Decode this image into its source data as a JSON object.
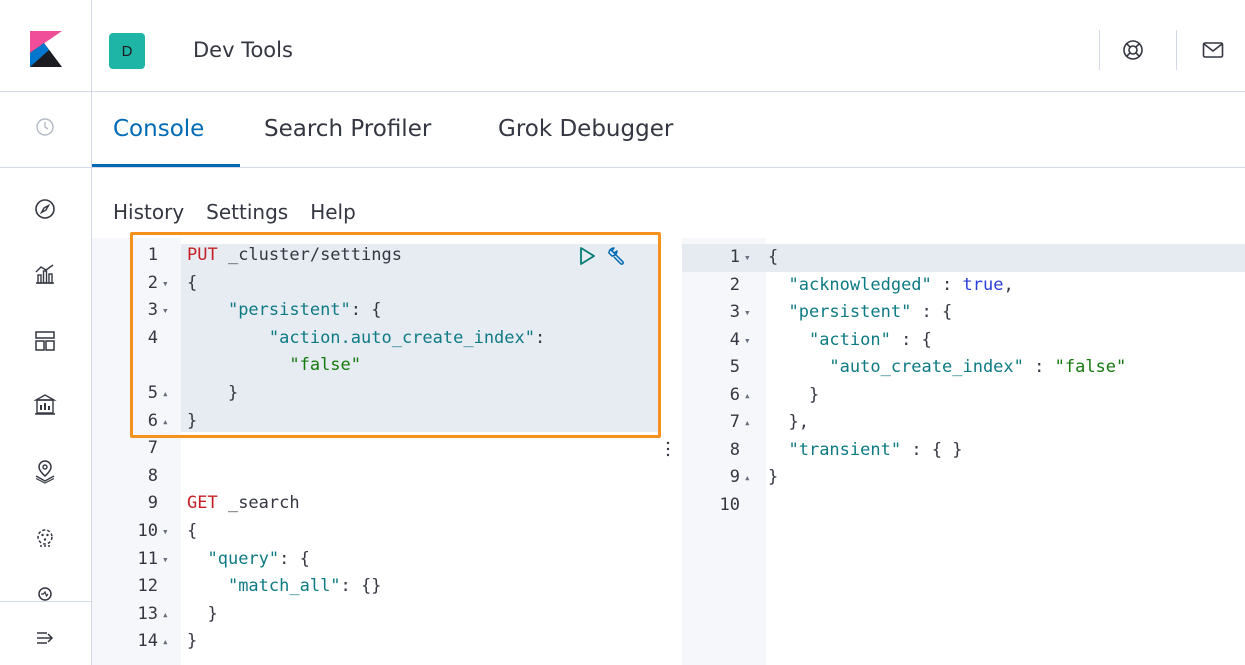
{
  "header": {
    "space_initial": "D",
    "app_title": "Dev Tools",
    "help_icon": "lifebuoy-icon",
    "mail_icon": "mail-icon"
  },
  "nav": {
    "icons": [
      "clock-icon",
      "compass-icon",
      "visualize-icon",
      "dashboard-icon",
      "canvas-icon",
      "maps-icon",
      "ml-icon",
      "uptime-icon",
      "expand-icon"
    ]
  },
  "tabs": [
    {
      "label": "Console",
      "active": true
    },
    {
      "label": "Search Profiler",
      "active": false
    },
    {
      "label": "Grok Debugger",
      "active": false
    }
  ],
  "menu": {
    "history": "History",
    "settings": "Settings",
    "help": "Help"
  },
  "request_lines": [
    {
      "n": "1",
      "fold": "",
      "tokens": [
        [
          "kw",
          "PUT"
        ],
        [
          "plain",
          " _cluster/settings"
        ]
      ]
    },
    {
      "n": "2",
      "fold": "▾",
      "tokens": [
        [
          "plain",
          "{"
        ]
      ]
    },
    {
      "n": "3",
      "fold": "▾",
      "tokens": [
        [
          "plain",
          "    "
        ],
        [
          "key",
          "\"persistent\""
        ],
        [
          "plain",
          ": {"
        ]
      ]
    },
    {
      "n": "4",
      "fold": "",
      "tokens": [
        [
          "plain",
          "        "
        ],
        [
          "key",
          "\"action.auto_create_index\""
        ],
        [
          "plain",
          ":"
        ]
      ]
    },
    {
      "n": "",
      "fold": "",
      "tokens": [
        [
          "plain",
          "          "
        ],
        [
          "str",
          "\"false\""
        ]
      ]
    },
    {
      "n": "5",
      "fold": "▴",
      "tokens": [
        [
          "plain",
          "    }"
        ]
      ]
    },
    {
      "n": "6",
      "fold": "▴",
      "tokens": [
        [
          "plain",
          "}"
        ]
      ]
    },
    {
      "n": "7",
      "fold": "",
      "tokens": []
    },
    {
      "n": "8",
      "fold": "",
      "tokens": []
    },
    {
      "n": "9",
      "fold": "",
      "tokens": [
        [
          "kw",
          "GET"
        ],
        [
          "plain",
          " _search"
        ]
      ]
    },
    {
      "n": "10",
      "fold": "▾",
      "tokens": [
        [
          "plain",
          "{"
        ]
      ]
    },
    {
      "n": "11",
      "fold": "▾",
      "tokens": [
        [
          "plain",
          "  "
        ],
        [
          "key",
          "\"query\""
        ],
        [
          "plain",
          ": {"
        ]
      ]
    },
    {
      "n": "12",
      "fold": "",
      "tokens": [
        [
          "plain",
          "    "
        ],
        [
          "key",
          "\"match_all\""
        ],
        [
          "plain",
          ": {}"
        ]
      ]
    },
    {
      "n": "13",
      "fold": "▴",
      "tokens": [
        [
          "plain",
          "  }"
        ]
      ]
    },
    {
      "n": "14",
      "fold": "▴",
      "tokens": [
        [
          "plain",
          "}"
        ]
      ]
    }
  ],
  "response_lines": [
    {
      "n": "1",
      "fold": "▾",
      "tokens": [
        [
          "plain",
          "{"
        ]
      ]
    },
    {
      "n": "2",
      "fold": "",
      "tokens": [
        [
          "plain",
          "  "
        ],
        [
          "key",
          "\"acknowledged\""
        ],
        [
          "plain",
          " : "
        ],
        [
          "bool",
          "true"
        ],
        [
          "plain",
          ","
        ]
      ]
    },
    {
      "n": "3",
      "fold": "▾",
      "tokens": [
        [
          "plain",
          "  "
        ],
        [
          "key",
          "\"persistent\""
        ],
        [
          "plain",
          " : {"
        ]
      ]
    },
    {
      "n": "4",
      "fold": "▾",
      "tokens": [
        [
          "plain",
          "    "
        ],
        [
          "key",
          "\"action\""
        ],
        [
          "plain",
          " : {"
        ]
      ]
    },
    {
      "n": "5",
      "fold": "",
      "tokens": [
        [
          "plain",
          "      "
        ],
        [
          "key",
          "\"auto_create_index\""
        ],
        [
          "plain",
          " : "
        ],
        [
          "str",
          "\"false\""
        ]
      ]
    },
    {
      "n": "6",
      "fold": "▴",
      "tokens": [
        [
          "plain",
          "    }"
        ]
      ]
    },
    {
      "n": "7",
      "fold": "▴",
      "tokens": [
        [
          "plain",
          "  },"
        ]
      ]
    },
    {
      "n": "8",
      "fold": "",
      "tokens": [
        [
          "plain",
          "  "
        ],
        [
          "key",
          "\"transient\""
        ],
        [
          "plain",
          " : { }"
        ]
      ]
    },
    {
      "n": "9",
      "fold": "▴",
      "tokens": [
        [
          "plain",
          "}"
        ]
      ]
    },
    {
      "n": "10",
      "fold": "",
      "tokens": []
    }
  ],
  "colors": {
    "accent": "#006bb4",
    "highlight_border": "#f7911e",
    "method": "#c61e25",
    "key": "#0d7a84",
    "string": "#147a0e",
    "boolean": "#2a3ed8"
  }
}
